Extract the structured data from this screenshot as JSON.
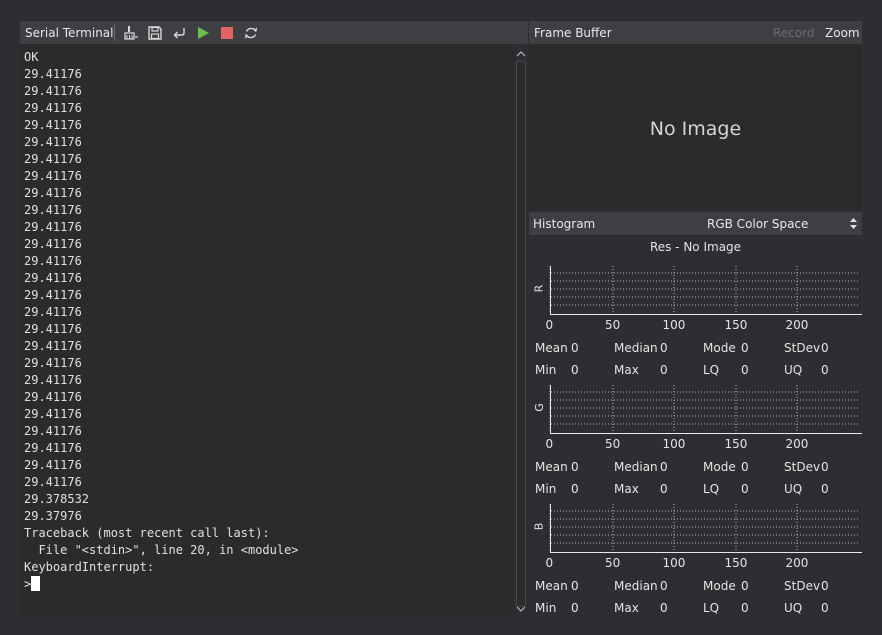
{
  "terminal": {
    "title": "Serial Terminal",
    "toolbar": [
      {
        "name": "clear-icon"
      },
      {
        "name": "save-icon"
      },
      {
        "name": "wrap-icon"
      },
      {
        "name": "play-icon",
        "color": "#6abf4b"
      },
      {
        "name": "stop-icon",
        "color": "#e06464"
      },
      {
        "name": "refresh-icon"
      }
    ],
    "lines": [
      "OK",
      "29.41176",
      "29.41176",
      "29.41176",
      "29.41176",
      "29.41176",
      "29.41176",
      "29.41176",
      "29.41176",
      "29.41176",
      "29.41176",
      "29.41176",
      "29.41176",
      "29.41176",
      "29.41176",
      "29.41176",
      "29.41176",
      "29.41176",
      "29.41176",
      "29.41176",
      "29.41176",
      "29.41176",
      "29.41176",
      "29.41176",
      "29.41176",
      "29.41176",
      "29.378532",
      "29.37976",
      "Traceback (most recent call last):",
      "  File \"<stdin>\", line 20, in <module>",
      "KeyboardInterrupt:"
    ],
    "prompt": ">"
  },
  "frame_buffer": {
    "title": "Frame Buffer",
    "record_label": "Record",
    "zoom_label": "Zoom",
    "placeholder": "No Image"
  },
  "histogram": {
    "title": "Histogram",
    "color_space": "RGB Color Space",
    "resolution_text": "Res - No Image",
    "x_ticks": [
      "0",
      "50",
      "100",
      "150",
      "200"
    ],
    "channels": [
      {
        "label": "R",
        "stats": {
          "Mean": "0",
          "Median": "0",
          "Mode": "0",
          "StDev": "0",
          "Min": "0",
          "Max": "0",
          "LQ": "0",
          "UQ": "0"
        }
      },
      {
        "label": "G",
        "stats": {
          "Mean": "0",
          "Median": "0",
          "Mode": "0",
          "StDev": "0",
          "Min": "0",
          "Max": "0",
          "LQ": "0",
          "UQ": "0"
        }
      },
      {
        "label": "B",
        "stats": {
          "Mean": "0",
          "Median": "0",
          "Mode": "0",
          "StDev": "0",
          "Min": "0",
          "Max": "0",
          "LQ": "0",
          "UQ": "0"
        }
      }
    ],
    "stat_order": [
      [
        "Mean",
        "Median",
        "Mode",
        "StDev"
      ],
      [
        "Min",
        "Max",
        "LQ",
        "UQ"
      ]
    ]
  },
  "colors": {
    "background": "#2d2e31",
    "header": "#3e3f43",
    "panel": "#2b2b2b",
    "text": "#e4e4e4",
    "disabled": "#6b6c70"
  }
}
